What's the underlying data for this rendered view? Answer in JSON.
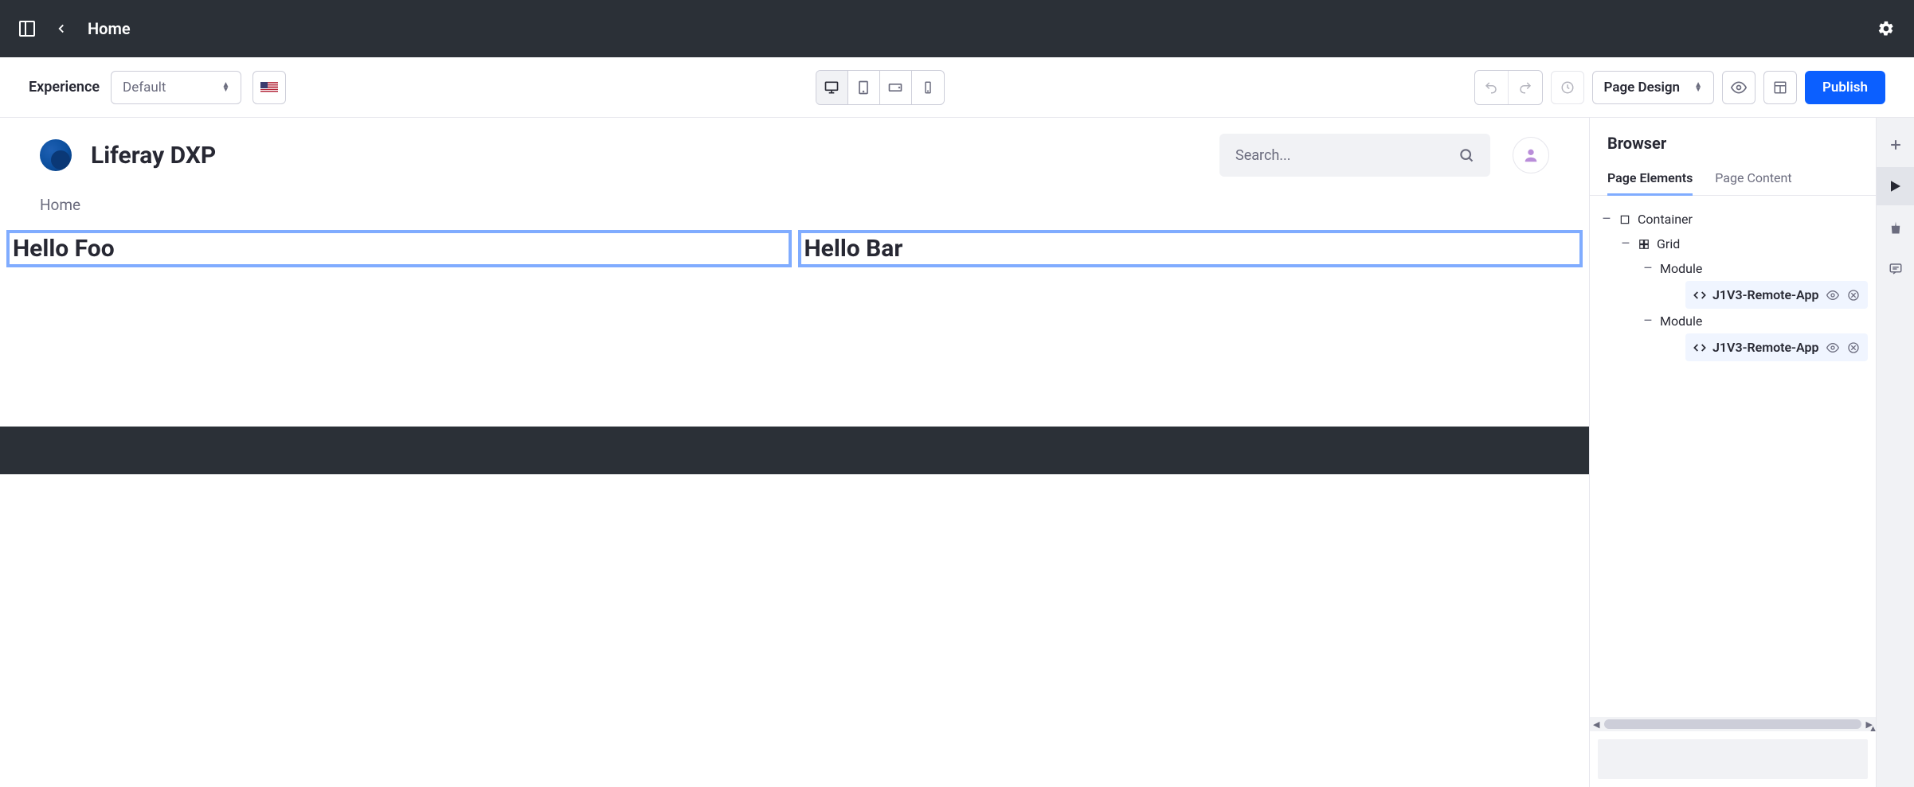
{
  "topbar": {
    "title": "Home"
  },
  "toolbar": {
    "experience_label": "Experience",
    "experience_value": "Default",
    "mode_value": "Page Design",
    "publish_label": "Publish"
  },
  "site": {
    "title": "Liferay DXP",
    "search_placeholder": "Search...",
    "breadcrumb": "Home"
  },
  "modules": {
    "left_text": "Hello Foo",
    "right_text": "Hello Bar"
  },
  "panel": {
    "title": "Browser",
    "tabs": {
      "elements": "Page Elements",
      "content": "Page Content"
    },
    "tree": {
      "container": "Container",
      "grid": "Grid",
      "module1": "Module",
      "leaf1": "J1V3-Remote-App",
      "module2": "Module",
      "leaf2": "J1V3-Remote-App"
    }
  }
}
